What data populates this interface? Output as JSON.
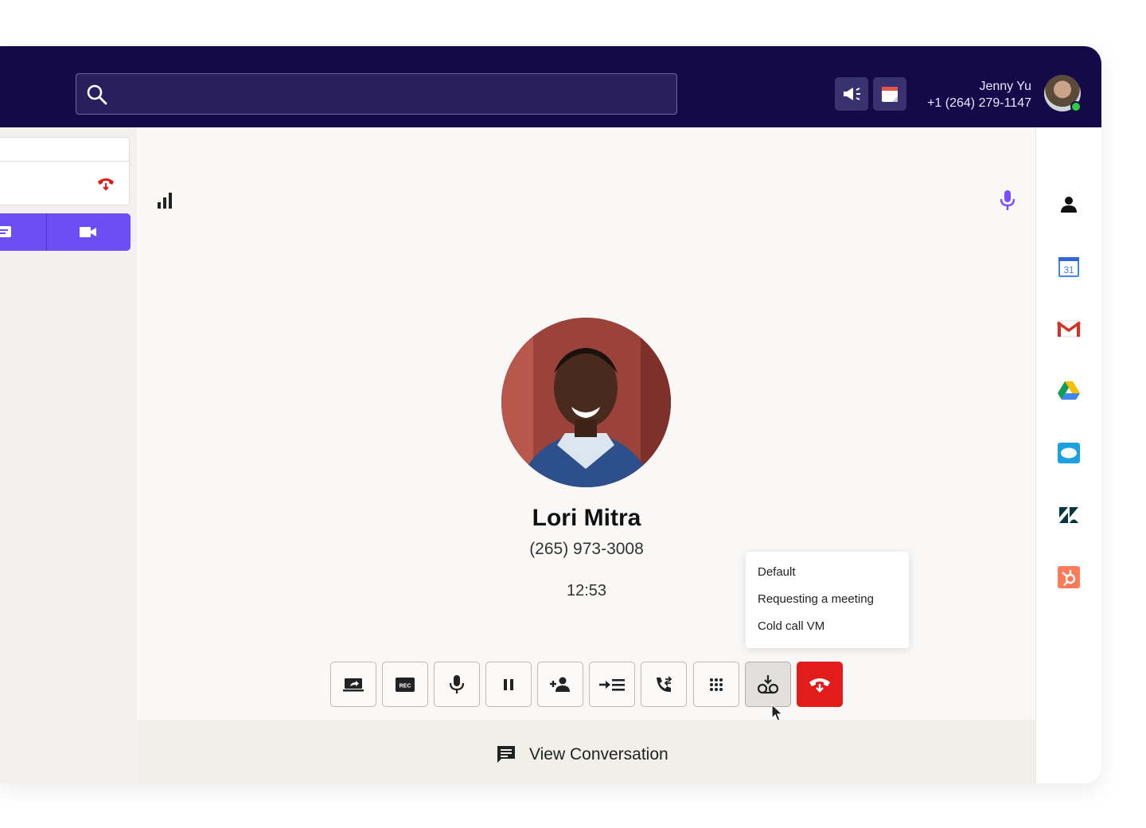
{
  "header": {
    "search_placeholder": "",
    "user_name": "Jenny Yu",
    "user_phone": "+1 (264) 279-1147",
    "announce_icon": "megaphone-icon",
    "calendar_icon": "calendar-note-icon",
    "status": "online"
  },
  "call": {
    "contact_name": "Lori Mitra",
    "contact_phone": "(265) 973-3008",
    "duration": "12:53"
  },
  "voicemail_menu": {
    "options": [
      "Default",
      "Requesting a meeting",
      "Cold call VM"
    ]
  },
  "controls": [
    {
      "name": "share-screen-button",
      "icon": "screen-share-icon"
    },
    {
      "name": "record-button",
      "icon": "rec-icon",
      "text": "REC"
    },
    {
      "name": "mute-button",
      "icon": "microphone-icon"
    },
    {
      "name": "hold-button",
      "icon": "pause-icon"
    },
    {
      "name": "add-participant-button",
      "icon": "person-add-icon"
    },
    {
      "name": "transfer-button",
      "icon": "transfer-icon"
    },
    {
      "name": "forward-call-button",
      "icon": "phone-forward-icon"
    },
    {
      "name": "keypad-button",
      "icon": "keypad-icon"
    },
    {
      "name": "voicemail-drop-button",
      "icon": "voicemail-drop-icon"
    },
    {
      "name": "hang-up-button",
      "icon": "hangup-icon"
    }
  ],
  "footer": {
    "view_conversation_label": "View Conversation"
  },
  "integrations": [
    {
      "name": "contact",
      "icon": "person-icon"
    },
    {
      "name": "google-calendar",
      "icon": "google-calendar-icon",
      "text": "31"
    },
    {
      "name": "gmail",
      "icon": "gmail-icon"
    },
    {
      "name": "google-drive",
      "icon": "google-drive-icon"
    },
    {
      "name": "salesforce",
      "icon": "salesforce-icon"
    },
    {
      "name": "zendesk",
      "icon": "zendesk-icon"
    },
    {
      "name": "hubspot",
      "icon": "hubspot-icon"
    }
  ],
  "colors": {
    "topbar": "#140a4a",
    "accent": "#6c4ef5",
    "hangup": "#e21b1b",
    "mic_active": "#7b4dff"
  }
}
